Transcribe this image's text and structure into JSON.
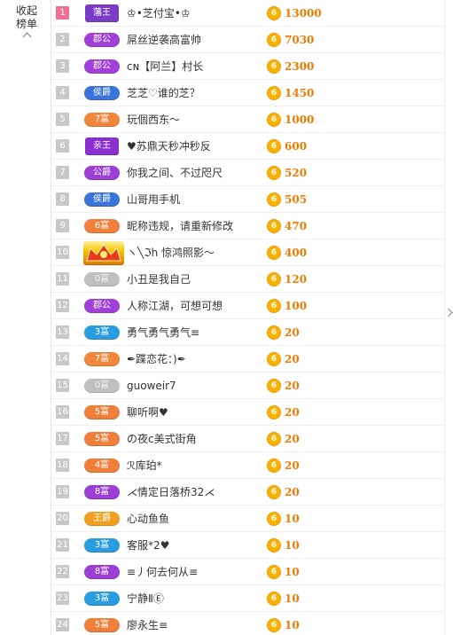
{
  "sidebar": {
    "collapse_line1": "收起",
    "collapse_line2": "榜单"
  },
  "rows": [
    {
      "rank": "1",
      "badge": "藩王",
      "badge_color": "#7a3cc6",
      "badge_style": "crown",
      "name": "♔•芝付宝•♔",
      "score": "13000"
    },
    {
      "rank": "2",
      "badge": "郡公",
      "badge_color": "#a040d8",
      "badge_style": "pill",
      "name": "屌丝逆袭高富帅",
      "score": "7030"
    },
    {
      "rank": "3",
      "badge": "郡公",
      "badge_color": "#a040d8",
      "badge_style": "pill",
      "name": "ᴄɴ【阿兰】村长",
      "score": "2300"
    },
    {
      "rank": "4",
      "badge": "侯爵",
      "badge_color": "#3a74d8",
      "badge_style": "pill",
      "name": "芝芝♡谁的芝？",
      "score": "1450"
    },
    {
      "rank": "5",
      "badge": "7富",
      "badge_color": "#f0873a",
      "badge_style": "pill",
      "name": "玩個西东～",
      "score": "1000"
    },
    {
      "rank": "6",
      "badge": "亲王",
      "badge_color": "#8a2fd0",
      "badge_style": "crown",
      "name": "♥苏鼎天秒冲秒反",
      "score": "600"
    },
    {
      "rank": "7",
      "badge": "公爵",
      "badge_color": "#9c3fd6",
      "badge_style": "pill",
      "name": "你我之间、不过咫尺",
      "score": "520"
    },
    {
      "rank": "8",
      "badge": "侯爵",
      "badge_color": "#3a74d8",
      "badge_style": "pill",
      "name": "山哥用手机",
      "score": "505"
    },
    {
      "rank": "9",
      "badge": "6富",
      "badge_color": "#f07f3a",
      "badge_style": "pill",
      "name": "昵称违规，请重新修改",
      "score": "470"
    },
    {
      "rank": "10",
      "badge": "",
      "badge_color": "#e8b000",
      "badge_style": "big",
      "name": "ヽ╲ℑh 惊鸿照影～",
      "score": "400"
    },
    {
      "rank": "11",
      "badge": "0富",
      "badge_color": "#c0c0c0",
      "badge_style": "grey",
      "name": "小丑是我自己",
      "score": "120"
    },
    {
      "rank": "12",
      "badge": "郡公",
      "badge_color": "#a040d8",
      "badge_style": "pill",
      "name": "人称江湖，可想可想",
      "score": "100"
    },
    {
      "rank": "13",
      "badge": "3富",
      "badge_color": "#2a9de0",
      "badge_style": "pill",
      "name": "勇气勇气勇气≡",
      "score": "20"
    },
    {
      "rank": "14",
      "badge": "7富",
      "badge_color": "#f0873a",
      "badge_style": "pill",
      "name": "✒蹀恋花：)✒",
      "score": "20"
    },
    {
      "rank": "15",
      "badge": "0富",
      "badge_color": "#c0c0c0",
      "badge_style": "grey",
      "name": "guoweir7",
      "score": "20"
    },
    {
      "rank": "16",
      "badge": "5富",
      "badge_color": "#f07f3a",
      "badge_style": "pill",
      "name": "聊听啊♥",
      "score": "20"
    },
    {
      "rank": "17",
      "badge": "5富",
      "badge_color": "#f07f3a",
      "badge_style": "pill",
      "name": "の夜ᴄ美式街角",
      "score": "20"
    },
    {
      "rank": "18",
      "badge": "4富",
      "badge_color": "#f07f3a",
      "badge_style": "pill",
      "name": "ℛ库珀*",
      "score": "20"
    },
    {
      "rank": "19",
      "badge": "8富",
      "badge_color": "#9c3fd6",
      "badge_style": "pill",
      "name": "⋌情定日落桥32⋌",
      "score": "20"
    },
    {
      "rank": "20",
      "badge": "王爵",
      "badge_color": "#f0a020",
      "badge_style": "pill",
      "name": "心动鱼鱼",
      "score": "10"
    },
    {
      "rank": "21",
      "badge": "3富",
      "badge_color": "#2a9de0",
      "badge_style": "pill",
      "name": "客服*2♥",
      "score": "10"
    },
    {
      "rank": "22",
      "badge": "8富",
      "badge_color": "#9c3fd6",
      "badge_style": "pill",
      "name": "≡丿何去何从≡",
      "score": "10"
    },
    {
      "rank": "23",
      "badge": "3富",
      "badge_color": "#2a9de0",
      "badge_style": "pill",
      "name": "宁静ⅡⒺ",
      "score": "10"
    },
    {
      "rank": "24",
      "badge": "5富",
      "badge_color": "#f07f3a",
      "badge_style": "pill",
      "name": "廖永生≡",
      "score": "10"
    }
  ],
  "coin_glyph": "6",
  "colors": {
    "rank_top": "#f06e93",
    "rank_default": "#c8c8c8",
    "score": "#f07a00",
    "coin": "#f8b300"
  },
  "icons": {
    "collapse": "chevron-up-icon",
    "scroll": "chevron-right-icon",
    "coin": "gold-coin-icon",
    "big_badge": "golden-crown-icon"
  }
}
